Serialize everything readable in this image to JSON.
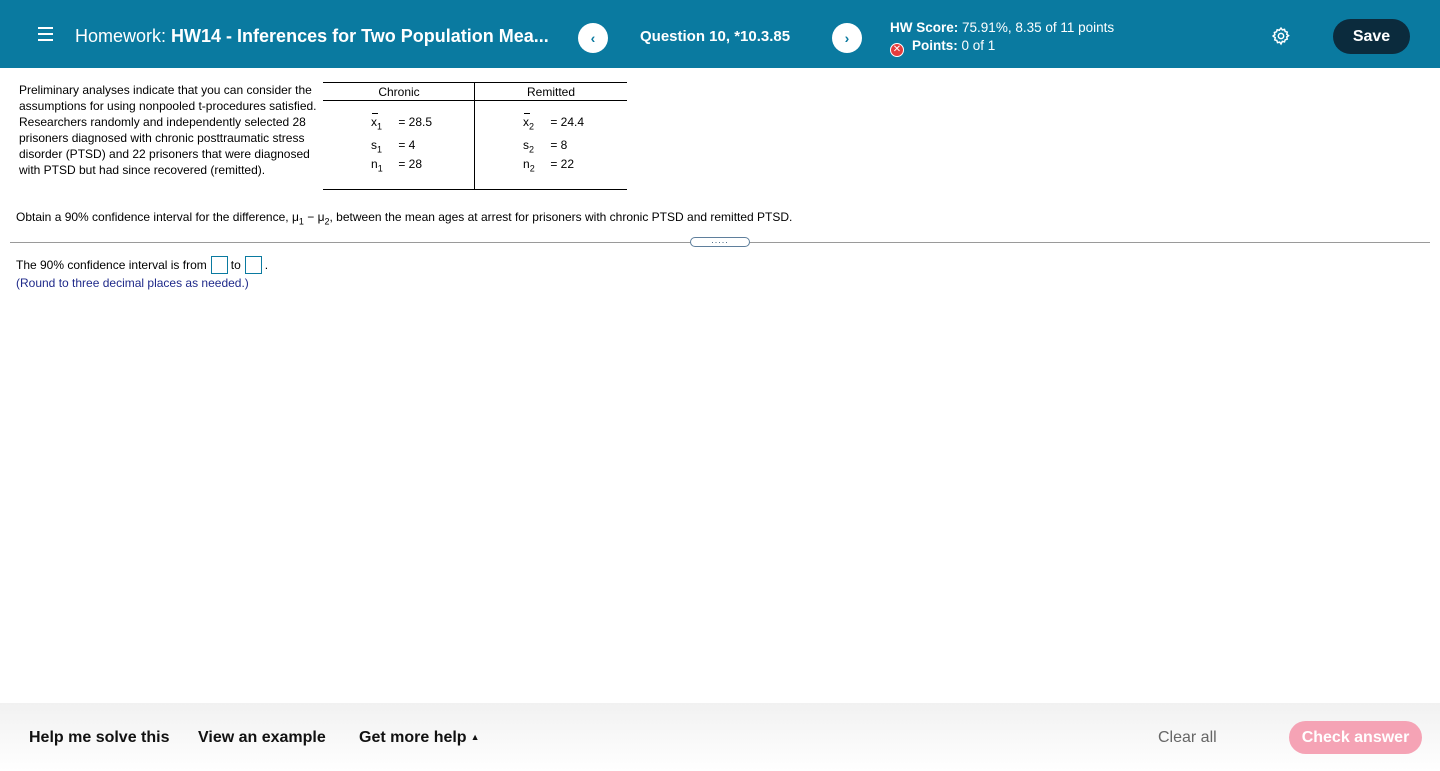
{
  "header": {
    "homework_prefix": "Homework:",
    "homework_title": "HW14 - Inferences for Two Population Mea...",
    "prev_label": "‹",
    "next_label": "›",
    "question": "Question 10, *10.3.85",
    "score_label": "HW Score:",
    "score_value": "75.91%, 8.35 of 11 points",
    "points_label": "Points:",
    "points_value": "0 of 1",
    "save_label": "Save",
    "colors": {
      "bar": "#0a7aa0",
      "save": "#0b2b3d",
      "error": "#e33c3c"
    }
  },
  "question": {
    "intro": "Preliminary analyses indicate that you can consider the assumptions for using nonpooled t-procedures satisfied. Researchers randomly and independently selected 28 prisoners diagnosed with chronic posttraumatic stress disorder (PTSD) and 22 prisoners that were diagnosed with PTSD but had since recovered (remitted).",
    "table": {
      "col1_header": "Chronic",
      "col2_header": "Remitted",
      "col1": [
        {
          "sym": "x",
          "sub": "1",
          "value": "= 28.5"
        },
        {
          "sym": "s",
          "sub": "1",
          "value": "= 4"
        },
        {
          "sym": "n",
          "sub": "1",
          "value": "= 28"
        }
      ],
      "col2": [
        {
          "sym": "x",
          "sub": "2",
          "value": "= 24.4"
        },
        {
          "sym": "s",
          "sub": "2",
          "value": "= 8"
        },
        {
          "sym": "n",
          "sub": "2",
          "value": "= 22"
        }
      ]
    },
    "prompt_before": "Obtain a 90% confidence interval for the difference, ",
    "mu": "μ",
    "sub1": "1",
    "minus": " − ",
    "sub2": "2",
    "prompt_after": ", between the mean ages at arrest for prisoners with chronic PTSD and remitted PTSD.",
    "handle": "....."
  },
  "answer": {
    "before": "The 90% confidence interval is from",
    "middle": "to",
    "after": ".",
    "note": "(Round to three decimal places as needed.)"
  },
  "footer": {
    "help": "Help me solve this",
    "example": "View an example",
    "more": "Get more help",
    "more_caret": "▲",
    "clear": "Clear all",
    "check": "Check answer",
    "check_color": "#f5a3b5"
  }
}
